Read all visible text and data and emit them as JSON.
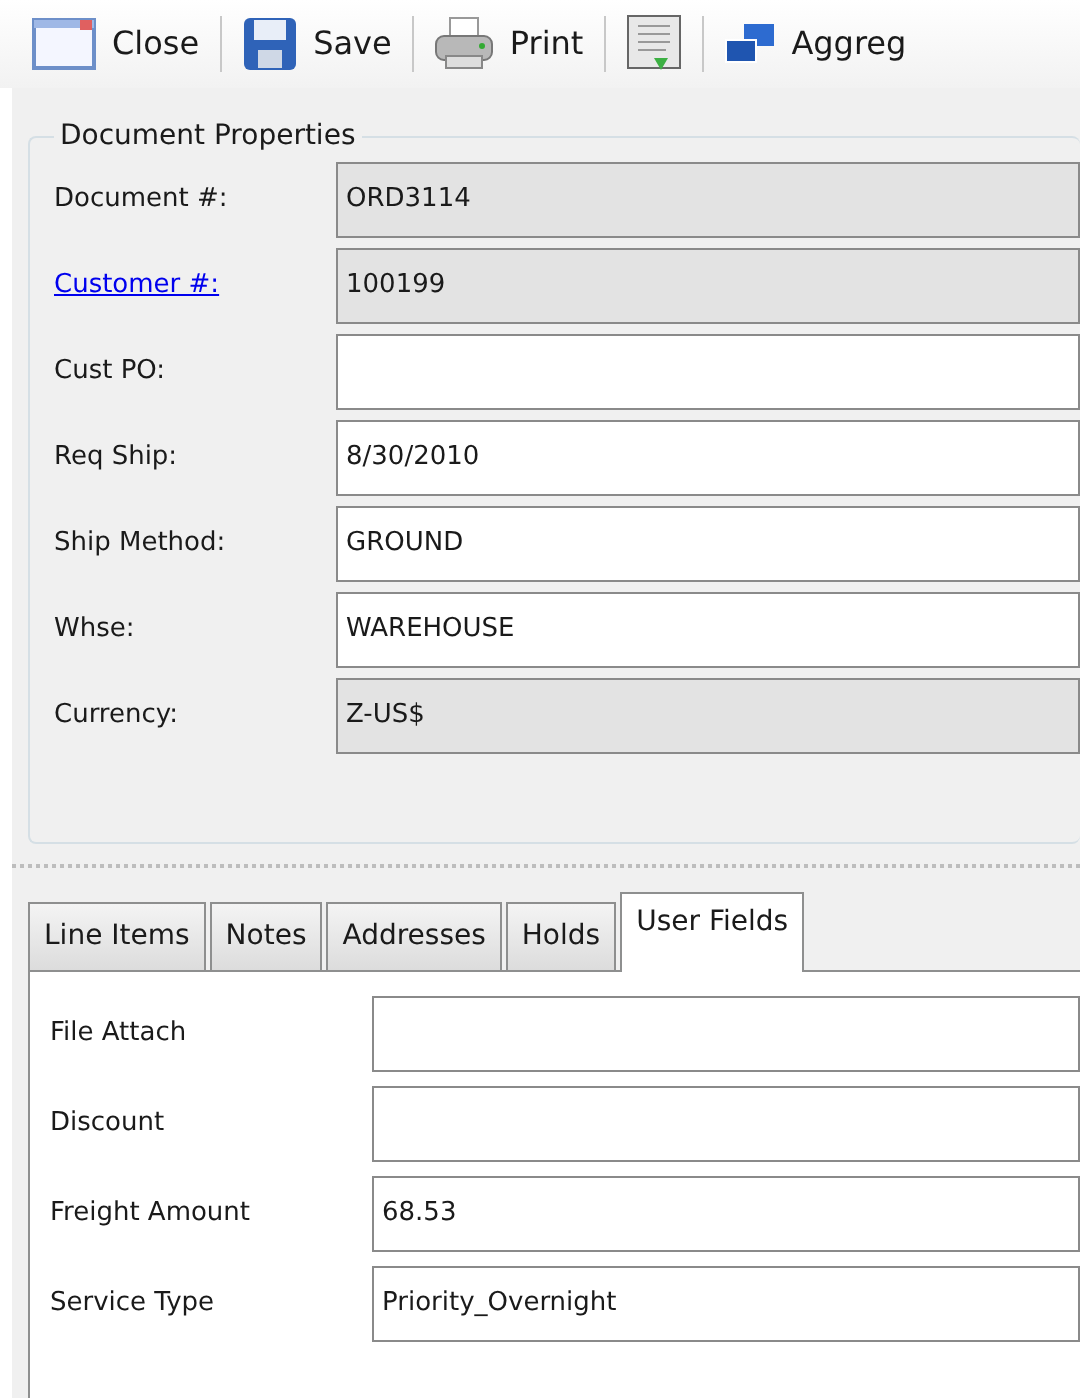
{
  "toolbar": [
    {
      "kind": "close",
      "label": "Close"
    },
    {
      "kind": "save",
      "label": "Save"
    },
    {
      "kind": "print",
      "label": "Print"
    },
    {
      "kind": "export"
    },
    {
      "kind": "aggregate",
      "label": "Aggreg"
    }
  ],
  "document_properties": {
    "title": "Document Properties",
    "fields": [
      {
        "label": "Document #:",
        "value": "ORD3114",
        "readonly": true,
        "link": false
      },
      {
        "label": "Customer #:",
        "value": "100199",
        "readonly": true,
        "link": true
      },
      {
        "label": "Cust PO:",
        "readonly": false,
        "link": false
      },
      {
        "label": "Req Ship:",
        "value": "8/30/2010",
        "readonly": false,
        "link": false
      },
      {
        "label": "Ship Method:",
        "value": "GROUND",
        "readonly": false,
        "link": false
      },
      {
        "label": "Whse:",
        "value": "WAREHOUSE",
        "readonly": false,
        "link": false
      },
      {
        "label": "Currency:",
        "value": "Z-US$",
        "readonly": true,
        "link": false
      }
    ]
  },
  "tabs": [
    {
      "label": "Line Items",
      "selected": false
    },
    {
      "label": "Notes",
      "selected": false
    },
    {
      "label": "Addresses",
      "selected": false
    },
    {
      "label": "Holds",
      "selected": false
    },
    {
      "label": "User Fields",
      "selected": true
    }
  ],
  "user_fields": [
    {
      "label": "File Attach"
    },
    {
      "label": "Discount"
    },
    {
      "label": "Freight Amount",
      "value": "68.53"
    },
    {
      "label": "Service Type",
      "value": "Priority_Overnight"
    }
  ]
}
